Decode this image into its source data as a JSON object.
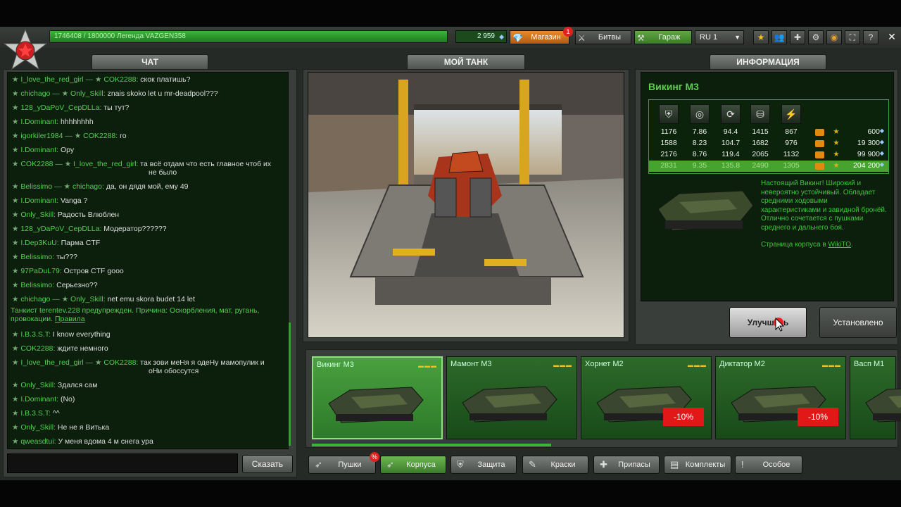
{
  "topbar": {
    "xp_text": "1746408 / 1800000  Легенда VAZGEN358",
    "crystals": "2 959",
    "shop_label": "Магазин",
    "shop_badge": "1",
    "battles_label": "Битвы",
    "garage_label": "Гараж",
    "lang": "RU 1"
  },
  "tabs": {
    "chat": "ЧАТ",
    "tank": "МОЙ ТАНК",
    "info": "ИНФОРМАЦИЯ"
  },
  "chat": {
    "messages": [
      {
        "from": "I_love_the_red_girl",
        "to": "COK2288",
        "text": "скок платишь?"
      },
      {
        "from": "chichago",
        "to": "Only_Skill",
        "text": "znais skoko let u mr-deadpool???"
      },
      {
        "from": "128_yDaPoV_CepDLLa",
        "to": "",
        "text": "ты тут?"
      },
      {
        "from": "I.Dominant",
        "to": "",
        "text": "hhhhhhhh"
      },
      {
        "from": "igorkiler1984",
        "to": "COK2288",
        "text": "го"
      },
      {
        "from": "I.Dominant",
        "to": "",
        "text": "Ору"
      },
      {
        "from": "COK2288",
        "to": "I_love_the_red_girl",
        "text": "та всё отдам что есть главное чтоб их",
        "text2": "не было"
      },
      {
        "from": "Belissimo",
        "to": "chichago",
        "text": "да, он дядя мой, ему 49"
      },
      {
        "from": "I.Dominant",
        "to": "",
        "text": "Vanga ?"
      },
      {
        "from": "Only_Skill",
        "to": "",
        "text": "Радость Влюблен"
      },
      {
        "from": "128_yDaPoV_CepDLLa",
        "to": "",
        "text": "Модератор??????"
      },
      {
        "from": "I.Dep3KuU",
        "to": "",
        "text": "Парма CTF"
      },
      {
        "from": "Belissimo",
        "to": "",
        "text": "ты???"
      },
      {
        "from": "97PaDuL79",
        "to": "",
        "text": "Остров CTF gooo"
      },
      {
        "from": "Belissimo",
        "to": "",
        "text": "Серьезно??"
      },
      {
        "from": "chichago",
        "to": "Only_Skill",
        "text": "net emu skora budet 14 let"
      }
    ],
    "system_line1": "Танкист terentev.228 предупрежден. Причина: Оскорбления, мат, ругань,",
    "system_line2": "провокации.",
    "system_link": "Правила",
    "messages2": [
      {
        "from": "I.B.3.S.T",
        "to": "",
        "text": "I know everything"
      },
      {
        "from": "COK2288",
        "to": "",
        "text": "ждите немного"
      },
      {
        "from": "I_love_the_red_girl",
        "to": "COK2288",
        "text": "так зови меНя я одеНу мамопулик и",
        "text2": "оНи обоссутся"
      },
      {
        "from": "Only_Skill",
        "to": "",
        "text": "Здался сам"
      },
      {
        "from": "I.Dominant",
        "to": "",
        "text": "(No)"
      },
      {
        "from": "I.B.3.S.T",
        "to": "",
        "text": "^^"
      },
      {
        "from": "Only_Skill",
        "to": "",
        "text": "Не не я Витька"
      },
      {
        "from": "qweasdtui",
        "to": "",
        "text": "У меня вдома 4 м снега ура"
      }
    ],
    "send_label": "Сказать"
  },
  "info": {
    "title": "Викинг М3",
    "stat_icons": [
      "armor-icon",
      "speed-icon",
      "turn-icon",
      "weight-icon",
      "power-icon"
    ],
    "rows": [
      {
        "v": [
          "1176",
          "7.86",
          "94.4",
          "1415",
          "867"
        ],
        "lvl": "M0",
        "price": "600"
      },
      {
        "v": [
          "1588",
          "8.23",
          "104.7",
          "1682",
          "976"
        ],
        "lvl": "M1",
        "price": "19 300"
      },
      {
        "v": [
          "2176",
          "8.76",
          "119.4",
          "2065",
          "1132"
        ],
        "lvl": "M2",
        "price": "99 900"
      },
      {
        "v": [
          "2831",
          "9.35",
          "135.8",
          "2490",
          "1305"
        ],
        "lvl": "M3",
        "price": "204 200"
      }
    ],
    "desc_text": "Настоящий Викинг! Широкий и невероятно устойчивый. Обладает средними ходовыми характеристиками и завидной бронёй. Отлично сочетается с пушками среднего и дальнего боя.",
    "wiki_prefix": "Страница корпуса в ",
    "wiki_link": "WikiTO",
    "wiki_suffix": "."
  },
  "actions": {
    "upgrade": "Улучшить",
    "installed": "Установлено"
  },
  "items": [
    {
      "name": "Викинг М3",
      "discount": ""
    },
    {
      "name": "Мамонт М3",
      "discount": ""
    },
    {
      "name": "Хорнет М2",
      "discount": "-10%"
    },
    {
      "name": "Диктатор М2",
      "discount": "-10%"
    },
    {
      "name": "Васп М1",
      "discount": ""
    }
  ],
  "categories": [
    "Пушки",
    "Корпуса",
    "Защита",
    "Краски",
    "Припасы",
    "Комплекты",
    "Особое"
  ],
  "colors": {
    "accent": "#3cb43c",
    "shop": "#e98a2a",
    "discount": "#e21818"
  }
}
